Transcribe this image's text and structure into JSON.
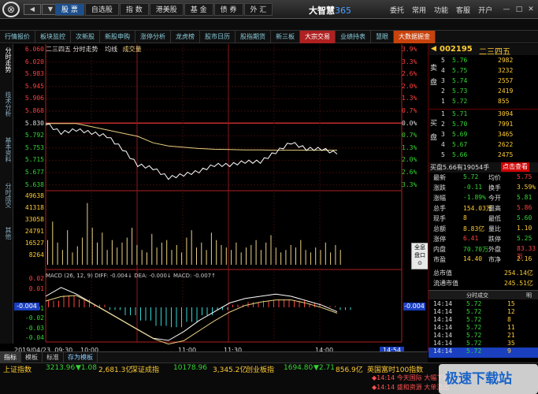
{
  "titlebar": {
    "logo": "⊗",
    "tabs": [
      "股 票",
      "自选股",
      "指 数",
      "港美股",
      "基 金",
      "债 券",
      "外 汇"
    ],
    "brand": "大智慧",
    "brand_version": "365",
    "menu": [
      "委托",
      "常用",
      "功能",
      "客服",
      "开户"
    ]
  },
  "subtabs": [
    "行情报价",
    "板块监控",
    "次新股",
    "新股申购",
    "涨停分析",
    "龙虎榜",
    "股市日历",
    "股指期货",
    "新三板",
    "大宗交易",
    "业绩持表",
    "慧眼",
    "大数据掘金"
  ],
  "vtabs": [
    "分时走势",
    "技术分析",
    "基本资料",
    "分时成交",
    "其他"
  ],
  "chart": {
    "title": "二三四五  分时走势",
    "legend_avg": "均线",
    "legend_vol": "成交量",
    "price_ticks": [
      "6.060",
      "6.020",
      "5.983",
      "5.945",
      "5.906",
      "5.868",
      "5.830",
      "5.792",
      "5.753",
      "5.715",
      "5.677",
      "5.638"
    ],
    "pct_ticks": [
      "3.9%",
      "3.3%",
      "2.6%",
      "2.0%",
      "1.3%",
      "0.7%",
      "0.0%",
      "0.7%",
      "1.3%",
      "2.0%",
      "2.6%",
      "3.3%"
    ],
    "vol_ticks": [
      "49638",
      "41318",
      "33058",
      "24791",
      "16527",
      "8264"
    ],
    "macd_label": "MACD (26, 12, 9)  DIFF: -0.004↓  DEA: -0.000↓  MACD: -0.007↑",
    "macd_ticks": [
      "0.02",
      "0.01",
      "-0.004",
      "-0.01",
      "-0.02",
      "-0.03",
      "-0.04"
    ],
    "macd_marker_left": "-0.004",
    "macd_marker_right": "-0.004",
    "time_labels": [
      "2019/04/23, 09:30",
      "10:00",
      "11:00",
      "11:30",
      "14:00",
      "14:54"
    ],
    "quick_panel": "全息\n盘口\n⊙"
  },
  "chart_data": {
    "type": "line",
    "title": "二三四五 分时走势",
    "prev_close": 5.83,
    "ylim": [
      5.638,
      6.06
    ],
    "series": [
      {
        "name": "均线",
        "color": "#e8d080",
        "values": [
          5.83,
          5.83,
          5.83,
          5.82,
          5.81,
          5.8,
          5.79,
          5.77,
          5.76,
          5.756,
          5.752,
          5.75,
          5.749,
          5.748,
          5.748,
          5.747,
          5.747,
          5.747,
          5.747,
          5.747
        ]
      },
      {
        "name": "price",
        "color": "#ffffff",
        "values": [
          5.83,
          5.8,
          5.81,
          5.8,
          5.79,
          5.75,
          5.7,
          5.69,
          5.66,
          5.67,
          5.68,
          5.7,
          5.7,
          5.71,
          5.71,
          5.74,
          5.77,
          5.75,
          5.75,
          5.735
        ]
      }
    ],
    "volume": [
      20,
      35,
      18,
      12,
      28,
      10,
      15,
      22,
      50,
      30,
      18,
      26,
      12,
      20,
      14,
      18,
      22,
      30,
      16,
      12,
      10,
      25,
      14,
      18,
      20,
      12,
      16,
      10,
      22,
      28,
      14,
      18,
      12,
      26,
      20,
      16,
      14,
      12,
      18,
      10,
      14,
      16,
      20,
      12,
      18,
      24,
      14,
      10,
      12,
      16,
      14,
      20,
      12,
      10,
      14,
      12,
      18,
      10,
      16,
      12
    ],
    "macd": [
      0.01,
      0.018,
      0.012,
      0.004,
      -0.004,
      -0.012,
      -0.02,
      -0.028,
      -0.03,
      -0.022,
      -0.012,
      -0.004,
      0.004,
      0.008,
      0.01,
      0.012,
      0.01,
      0.006,
      0.002,
      -0.004
    ]
  },
  "quote": {
    "code": "002195",
    "name": "二三四五",
    "sell_label": "卖\n盘",
    "buy_label": "买\n盘",
    "sells": [
      {
        "level": "5",
        "price": "5.76",
        "vol": "2982"
      },
      {
        "level": "4",
        "price": "5.75",
        "vol": "3232"
      },
      {
        "level": "3",
        "price": "5.74",
        "vol": "2557"
      },
      {
        "level": "2",
        "price": "5.73",
        "vol": "2419"
      },
      {
        "level": "1",
        "price": "5.72",
        "vol": "855"
      }
    ],
    "buys": [
      {
        "level": "1",
        "price": "5.71",
        "vol": "3094"
      },
      {
        "level": "2",
        "price": "5.70",
        "vol": "7991"
      },
      {
        "level": "3",
        "price": "5.69",
        "vol": "3465"
      },
      {
        "level": "4",
        "price": "5.67",
        "vol": "2622"
      },
      {
        "level": "5",
        "price": "5.66",
        "vol": "2475"
      }
    ],
    "bidline": "买盘5.66有19054手",
    "bidline_btn": "点击查看",
    "stats": [
      {
        "l1": "最新",
        "v1": "5.72",
        "c1": "green",
        "l2": "均价",
        "v2": "5.75",
        "c2": "red"
      },
      {
        "l1": "涨跌",
        "v1": "-0.11",
        "c1": "green",
        "l2": "换手",
        "v2": "3.59%",
        "c2": "yel"
      },
      {
        "l1": "涨幅",
        "v1": "-1.89%",
        "c1": "green",
        "l2": "今开",
        "v2": "5.81",
        "c2": "green"
      },
      {
        "l1": "总手",
        "v1": "154.03万",
        "c1": "yel",
        "l2": "最高",
        "v2": "5.86",
        "c2": "red"
      },
      {
        "l1": "现手",
        "v1": "8",
        "c1": "yel",
        "l2": "最低",
        "v2": "5.60",
        "c2": "green"
      },
      {
        "l1": "总额",
        "v1": "8.83亿",
        "c1": "yel",
        "l2": "量比",
        "v2": "1.10",
        "c2": "yel"
      },
      {
        "l1": "涨停",
        "v1": "6.41",
        "c1": "red",
        "l2": "跌停",
        "v2": "5.25",
        "c2": "green"
      },
      {
        "l1": "内盘",
        "v1": "70.70万",
        "c1": "green",
        "l2": "外盘",
        "v2": "83.33万",
        "c2": "red"
      },
      {
        "l1": "市盈",
        "v1": "14.40",
        "c1": "yel",
        "l2": "市净",
        "v2": "2.16",
        "c2": "yel"
      }
    ],
    "cap1_label": "总市值",
    "cap1_value": "254.14亿",
    "cap2_label": "流通市值",
    "cap2_value": "245.51亿",
    "ticks_title": "分时成交",
    "ticks_link": "明",
    "ticks": [
      {
        "t": "14:14",
        "p": "5.72",
        "v": "15",
        "flag": "",
        "c": "green"
      },
      {
        "t": "14:14",
        "p": "5.72",
        "v": "12",
        "flag": "",
        "c": "green"
      },
      {
        "t": "14:14",
        "p": "5.72",
        "v": "8",
        "flag": "",
        "c": "green"
      },
      {
        "t": "14:14",
        "p": "5.72",
        "v": "11",
        "flag": "",
        "c": "green"
      },
      {
        "t": "14:14",
        "p": "5.72",
        "v": "21",
        "flag": "",
        "c": "green"
      },
      {
        "t": "14:14",
        "p": "5.72",
        "v": "35",
        "flag": "",
        "c": "green"
      },
      {
        "t": "14:14",
        "p": "5.72",
        "v": "9",
        "flag": "",
        "c": "green"
      }
    ]
  },
  "bottombar": [
    "指标",
    "模板",
    "标准",
    "存为模板"
  ],
  "ticker": {
    "idx1_name": "上证指数",
    "idx1_val": "3213.96",
    "idx1_chg": "▼1.08",
    "idx1_amt": "2,681.3亿",
    "idx2_name": "深证成指",
    "idx2_val": "10178.96",
    "idx2_amt": "3,345.2亿",
    "idx3_name": "创业板指",
    "idx3_val": "1694.80",
    "idx3_chg": "▼2.71",
    "idx3_amt": "856.9亿",
    "idx4_name": "英国富时100指数"
  },
  "news": [
    "◆14:14 今天国际 大幅下跌",
    "◆14:14 盛和资源 大单流出"
  ],
  "watermark": "极速下载站"
}
